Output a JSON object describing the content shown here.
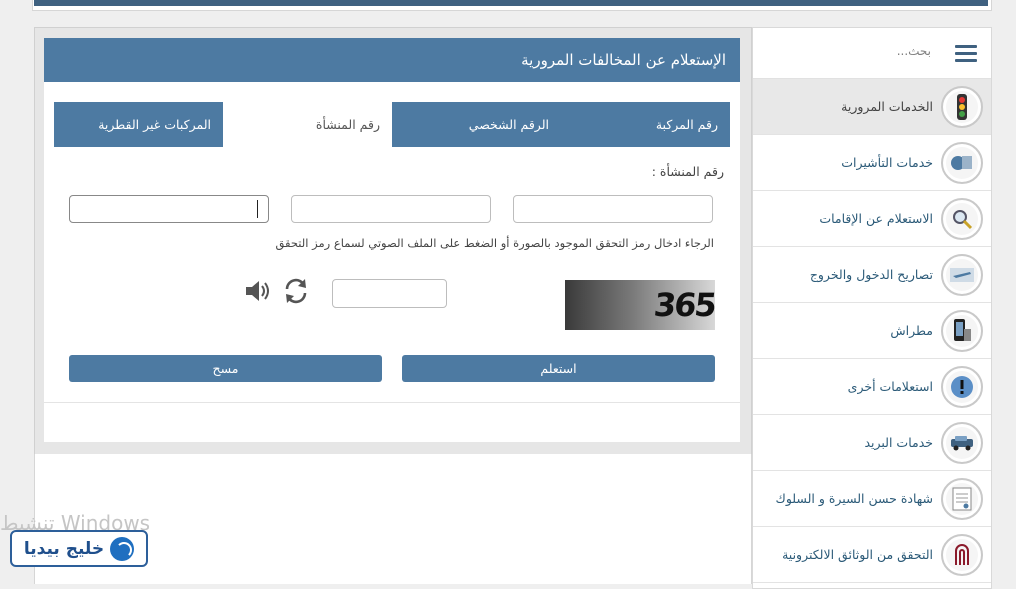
{
  "sidebar": {
    "search_placeholder": "بحث...",
    "items": [
      {
        "label": "الخدمات المرورية",
        "icon": "traffic-light-icon",
        "active": true
      },
      {
        "label": "خدمات التأشيرات",
        "icon": "visa-icon"
      },
      {
        "label": "الاستعلام عن الإقامات",
        "icon": "magnifier-icon"
      },
      {
        "label": "تصاريح الدخول والخروج",
        "icon": "airplane-icon"
      },
      {
        "label": "مطراش",
        "icon": "metrash-icon"
      },
      {
        "label": "استعلامات أخرى",
        "icon": "info-icon"
      },
      {
        "label": "خدمات البريد",
        "icon": "mail-car-icon"
      },
      {
        "label": "شهادة حسن السيرة و السلوك",
        "icon": "certificate-icon"
      },
      {
        "label": "التحقق من الوثائق الالكترونية",
        "icon": "fingerprint-icon"
      }
    ]
  },
  "panel": {
    "title": "الإستعلام عن المخالفات المرورية",
    "tabs": [
      {
        "label": "رقم المركبة"
      },
      {
        "label": "الرقم الشخصي"
      },
      {
        "label": "رقم المنشأة",
        "active": true
      },
      {
        "label": "المركبات غير القطرية"
      }
    ],
    "field_title": "رقم المنشأة :",
    "hint": "الرجاء ادخال رمز التحقق الموجود بالصورة أو الضغط على الملف الصوتي لسماع رمز التحقق",
    "captcha_text": "365",
    "submit_label": "استعلم",
    "clear_label": "مسح"
  },
  "watermark": "تنشيط Windows",
  "logo": {
    "text": "خليج بيديا"
  }
}
